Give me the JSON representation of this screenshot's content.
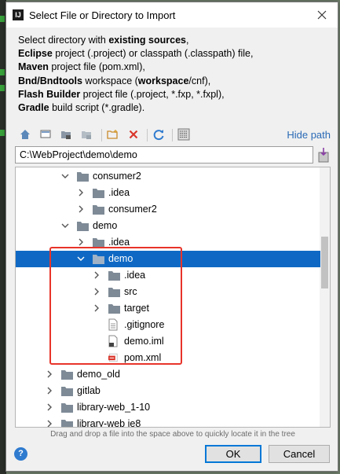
{
  "window": {
    "title": "Select File or Directory to Import",
    "app_icon": "IJ"
  },
  "description": [
    [
      {
        "t": "Select directory with ",
        "b": false
      },
      {
        "t": "existing sources",
        "b": true
      },
      {
        "t": ",",
        "b": false
      }
    ],
    [
      {
        "t": "Eclipse",
        "b": true
      },
      {
        "t": " project (.project) or classpath (.classpath) file,",
        "b": false
      }
    ],
    [
      {
        "t": "Maven",
        "b": true
      },
      {
        "t": " project file (pom.xml),",
        "b": false
      }
    ],
    [
      {
        "t": "Bnd/Bndtools",
        "b": true
      },
      {
        "t": " workspace (",
        "b": false
      },
      {
        "t": "workspace",
        "b": true
      },
      {
        "t": "/cnf),",
        "b": false
      }
    ],
    [
      {
        "t": "Flash Builder",
        "b": true
      },
      {
        "t": " project file (.project, *.fxp, *.fxpl),",
        "b": false
      }
    ],
    [
      {
        "t": "Gradle",
        "b": true
      },
      {
        "t": " build script (*.gradle).",
        "b": false
      }
    ]
  ],
  "toolbar": {
    "hide_path": "Hide path"
  },
  "path": {
    "value": "C:\\WebProject\\demo\\demo"
  },
  "tree": [
    {
      "label": "consumer2",
      "indent": 1,
      "arrow": "down",
      "icon": "folder"
    },
    {
      "label": ".idea",
      "indent": 2,
      "arrow": "right",
      "icon": "folder"
    },
    {
      "label": "consumer2",
      "indent": 2,
      "arrow": "right",
      "icon": "folder"
    },
    {
      "label": "demo",
      "indent": 1,
      "arrow": "down",
      "icon": "folder"
    },
    {
      "label": ".idea",
      "indent": 2,
      "arrow": "right",
      "icon": "folder"
    },
    {
      "label": "demo",
      "indent": 2,
      "arrow": "down",
      "icon": "folder",
      "selected": true
    },
    {
      "label": ".idea",
      "indent": 3,
      "arrow": "right",
      "icon": "folder"
    },
    {
      "label": "src",
      "indent": 3,
      "arrow": "right",
      "icon": "folder"
    },
    {
      "label": "target",
      "indent": 3,
      "arrow": "right",
      "icon": "folder"
    },
    {
      "label": ".gitignore",
      "indent": 3,
      "arrow": "none",
      "icon": "file"
    },
    {
      "label": "demo.iml",
      "indent": 3,
      "arrow": "none",
      "icon": "iml"
    },
    {
      "label": "pom.xml",
      "indent": 3,
      "arrow": "none",
      "icon": "maven"
    },
    {
      "label": "demo_old",
      "indent": 0,
      "arrow": "right",
      "icon": "folder"
    },
    {
      "label": "gitlab",
      "indent": 0,
      "arrow": "right",
      "icon": "folder"
    },
    {
      "label": "library-web_1-10",
      "indent": 0,
      "arrow": "right",
      "icon": "folder"
    },
    {
      "label": "library-web ie8",
      "indent": 0,
      "arrow": "right",
      "icon": "folder"
    }
  ],
  "hint": "Drag and drop a file into the space above to quickly locate it in the tree",
  "buttons": {
    "ok": "OK",
    "cancel": "Cancel",
    "help": "?"
  },
  "colors": {
    "selection": "#0f69c4",
    "highlight_box": "#e8342a",
    "link": "#2a6ab5",
    "folder": "#7e8a96"
  }
}
